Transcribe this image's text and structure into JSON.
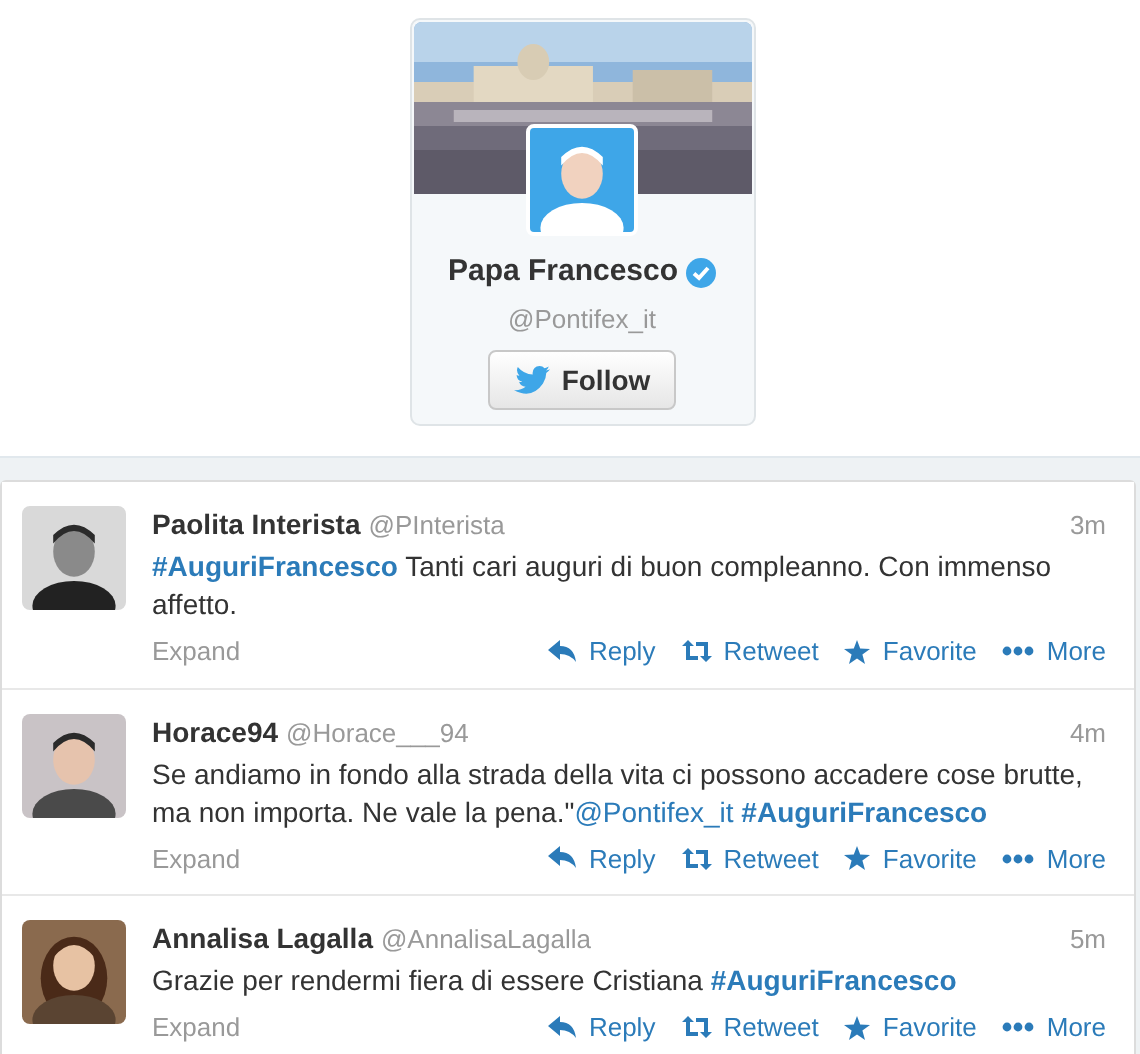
{
  "profile": {
    "name": "Papa Francesco",
    "verified": true,
    "handle": "@Pontifex_it",
    "follow_button": "Follow"
  },
  "tweets": [
    {
      "name": "Paolita Interista",
      "handle": "@PInterista",
      "time": "3m",
      "segments": [
        {
          "kind": "hashtag",
          "text": "#AuguriFrancesco"
        },
        {
          "kind": "text",
          "text": " Tanti cari auguri di buon compleanno. Con immenso affetto."
        }
      ],
      "expand": "Expand",
      "actions": [
        {
          "kind": "reply",
          "label": "Reply"
        },
        {
          "kind": "retweet",
          "label": "Retweet"
        },
        {
          "kind": "favorite",
          "label": "Favorite"
        },
        {
          "kind": "more",
          "label": "More"
        }
      ]
    },
    {
      "name": "Horace94",
      "handle": "@Horace___94",
      "time": "4m",
      "segments": [
        {
          "kind": "text",
          "text": "Se andiamo in fondo alla strada della vita ci possono accadere cose brutte, ma non importa. Ne vale la pena.\""
        },
        {
          "kind": "mention",
          "text": "@Pontifex_it"
        },
        {
          "kind": "hashtag",
          "text": " #AuguriFrancesco"
        }
      ],
      "expand": "Expand",
      "actions": [
        {
          "kind": "reply",
          "label": "Reply"
        },
        {
          "kind": "retweet",
          "label": "Retweet"
        },
        {
          "kind": "favorite",
          "label": "Favorite"
        },
        {
          "kind": "more",
          "label": "More"
        }
      ]
    },
    {
      "name": "Annalisa Lagalla",
      "handle": "@AnnalisaLagalla",
      "time": "5m",
      "segments": [
        {
          "kind": "text",
          "text": "Grazie per rendermi fiera di essere Cristiana "
        },
        {
          "kind": "hashtag",
          "text": "#AuguriFrancesco"
        }
      ],
      "expand": "Expand",
      "actions": [
        {
          "kind": "reply",
          "label": "Reply"
        },
        {
          "kind": "retweet",
          "label": "Retweet"
        },
        {
          "kind": "favorite",
          "label": "Favorite"
        },
        {
          "kind": "more",
          "label": "More"
        }
      ]
    }
  ]
}
